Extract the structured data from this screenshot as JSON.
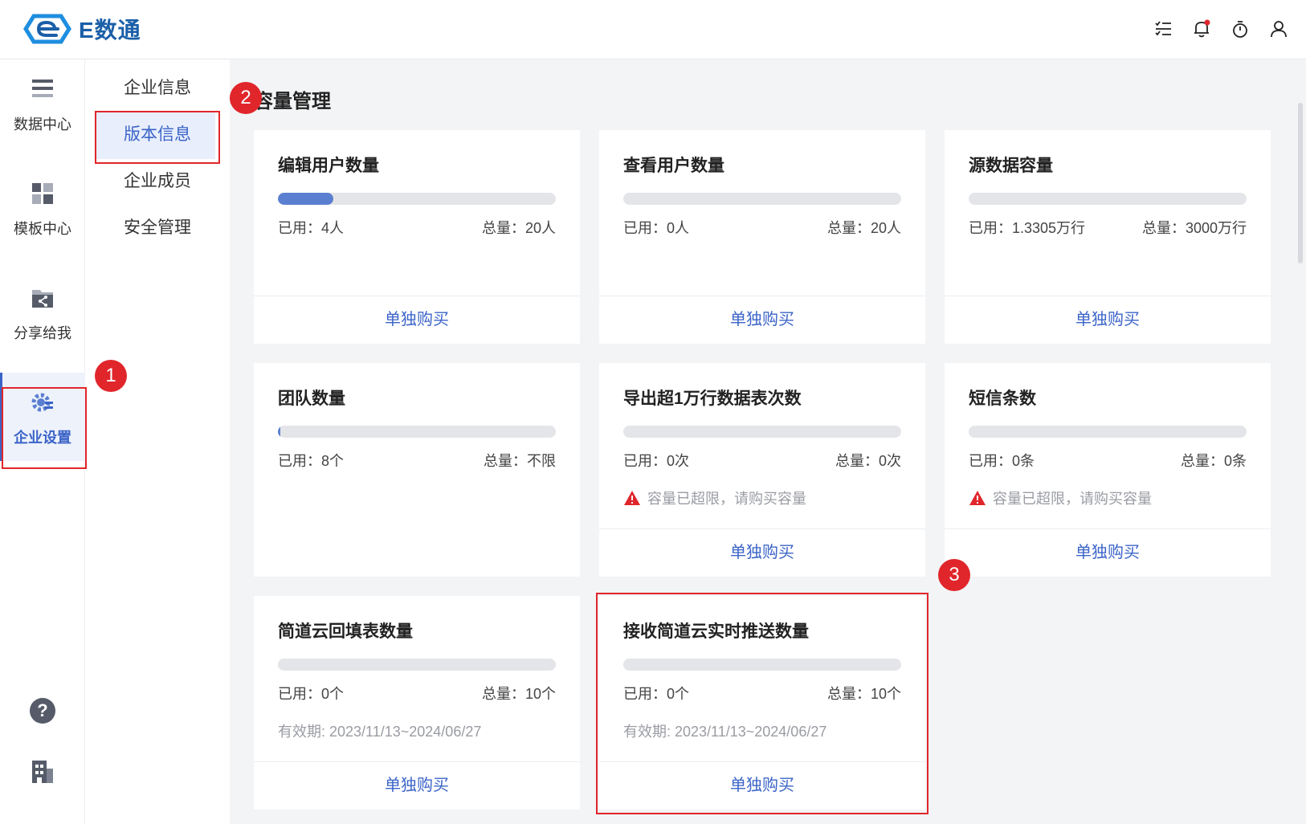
{
  "app": {
    "name": "E数通"
  },
  "header": {
    "icons": [
      "task-list-icon",
      "bell-icon",
      "timer-icon",
      "user-icon"
    ]
  },
  "rail": {
    "items": [
      {
        "label": "数据中心",
        "icon": "database-icon"
      },
      {
        "label": "模板中心",
        "icon": "template-icon"
      },
      {
        "label": "分享给我",
        "icon": "share-folder-icon"
      },
      {
        "label": "企业设置",
        "icon": "gear-icon",
        "active": true
      }
    ],
    "bottom_icons": [
      "help-icon",
      "building-icon"
    ]
  },
  "subnav": {
    "items": [
      {
        "label": "企业信息"
      },
      {
        "label": "版本信息",
        "active": true
      },
      {
        "label": "企业成员"
      },
      {
        "label": "安全管理"
      }
    ]
  },
  "main": {
    "title": "容量管理",
    "buy_label": "单独购买",
    "cards": [
      {
        "title": "编辑用户数量",
        "used": "已用：4人",
        "total": "总量：20人",
        "progress": 0.2
      },
      {
        "title": "查看用户数量",
        "used": "已用：0人",
        "total": "总量：20人",
        "progress": 0
      },
      {
        "title": "源数据容量",
        "used": "已用：1.3305万行",
        "total": "总量：3000万行",
        "progress": 0
      },
      {
        "title": "团队数量",
        "used": "已用：8个",
        "total": "总量：不限",
        "progress": 0.01
      },
      {
        "title": "导出超1万行数据表次数",
        "used": "已用：0次",
        "total": "总量：0次",
        "progress": 0,
        "note": "容量已超限，请购买容量"
      },
      {
        "title": "短信条数",
        "used": "已用：0条",
        "total": "总量：0条",
        "progress": 0,
        "note": "容量已超限，请购买容量"
      },
      {
        "title": "简道云回填表数量",
        "used": "已用：0个",
        "total": "总量：10个",
        "progress": 0,
        "note": "有效期: 2023/11/13~2024/06/27"
      },
      {
        "title": "接收简道云实时推送数量",
        "used": "已用：0个",
        "total": "总量：10个",
        "progress": 0,
        "note": "有效期: 2023/11/13~2024/06/27"
      }
    ]
  },
  "annotations": {
    "badges": [
      "1",
      "2",
      "3"
    ],
    "color": "#e0262b"
  },
  "colors": {
    "accent": "#3b64c8",
    "progress": "#5b7fd0",
    "brand": "#1b5fa8",
    "warning": "#e0262b"
  }
}
